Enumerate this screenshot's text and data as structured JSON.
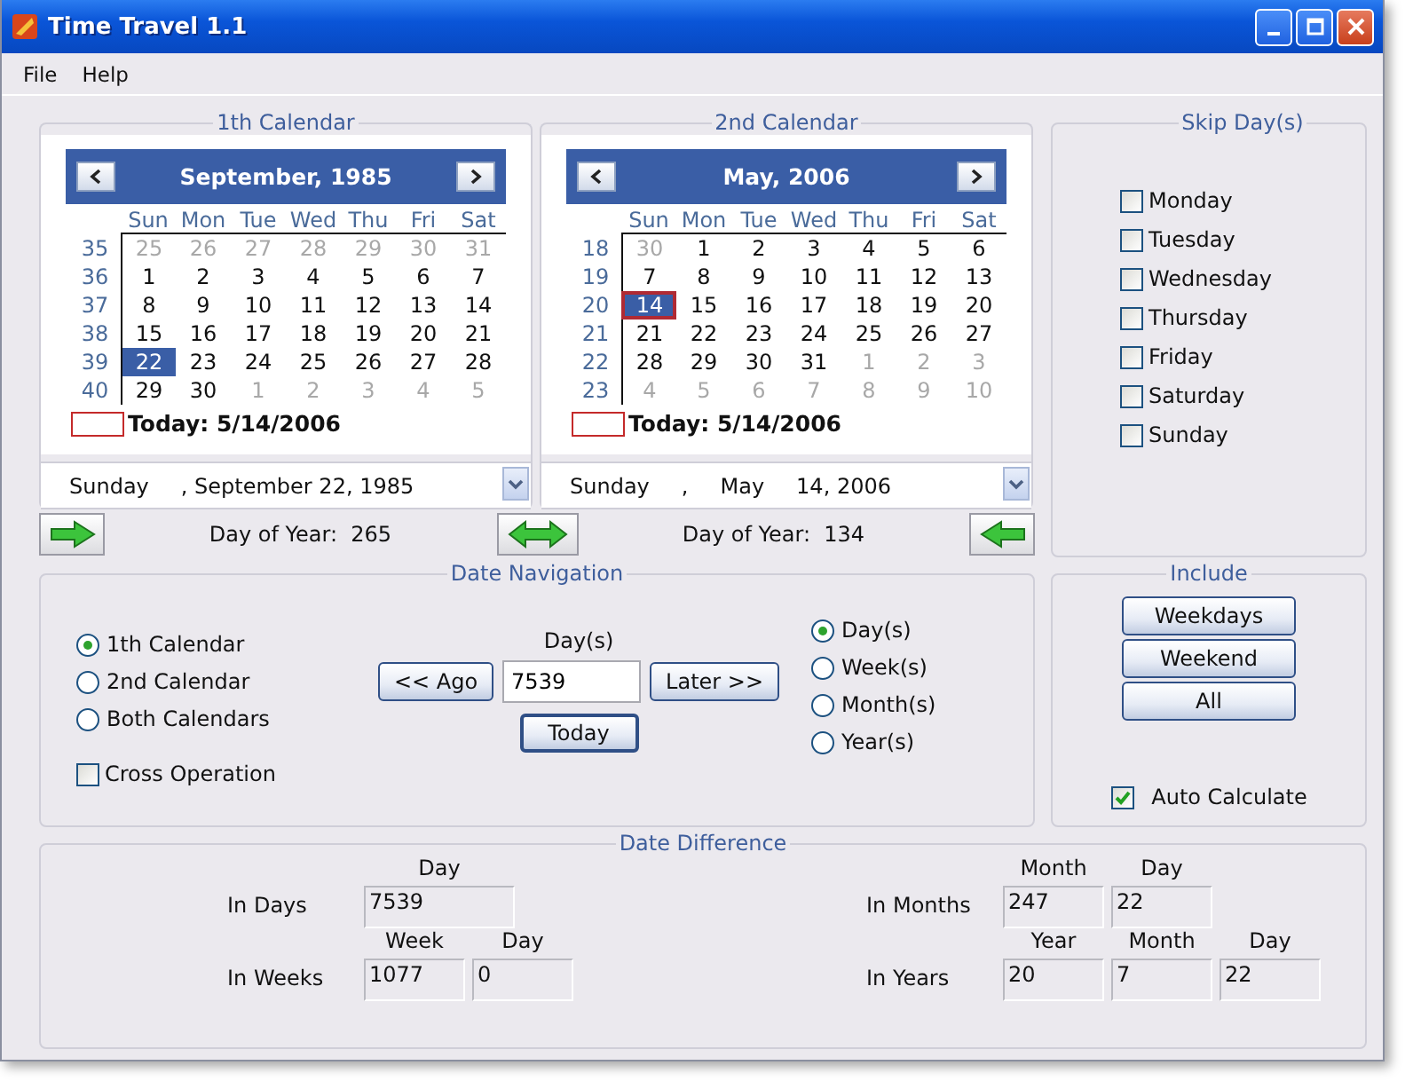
{
  "window": {
    "title": "Time Travel 1.1"
  },
  "menu": [
    "File",
    "Help"
  ],
  "calendars": [
    {
      "title": "1th Calendar",
      "month": "September, 1985",
      "weekdays": [
        "Sun",
        "Mon",
        "Tue",
        "Wed",
        "Thu",
        "Fri",
        "Sat"
      ],
      "weeks": [
        {
          "number": "35",
          "days": [
            {
              "d": "25",
              "other": true,
              "selected": false,
              "today": false
            },
            {
              "d": "26",
              "other": true,
              "selected": false,
              "today": false
            },
            {
              "d": "27",
              "other": true,
              "selected": false,
              "today": false
            },
            {
              "d": "28",
              "other": true,
              "selected": false,
              "today": false
            },
            {
              "d": "29",
              "other": true,
              "selected": false,
              "today": false
            },
            {
              "d": "30",
              "other": true,
              "selected": false,
              "today": false
            },
            {
              "d": "31",
              "other": true,
              "selected": false,
              "today": false
            }
          ]
        },
        {
          "number": "36",
          "days": [
            {
              "d": "1",
              "other": false,
              "selected": false,
              "today": false
            },
            {
              "d": "2",
              "other": false,
              "selected": false,
              "today": false
            },
            {
              "d": "3",
              "other": false,
              "selected": false,
              "today": false
            },
            {
              "d": "4",
              "other": false,
              "selected": false,
              "today": false
            },
            {
              "d": "5",
              "other": false,
              "selected": false,
              "today": false
            },
            {
              "d": "6",
              "other": false,
              "selected": false,
              "today": false
            },
            {
              "d": "7",
              "other": false,
              "selected": false,
              "today": false
            }
          ]
        },
        {
          "number": "37",
          "days": [
            {
              "d": "8",
              "other": false,
              "selected": false,
              "today": false
            },
            {
              "d": "9",
              "other": false,
              "selected": false,
              "today": false
            },
            {
              "d": "10",
              "other": false,
              "selected": false,
              "today": false
            },
            {
              "d": "11",
              "other": false,
              "selected": false,
              "today": false
            },
            {
              "d": "12",
              "other": false,
              "selected": false,
              "today": false
            },
            {
              "d": "13",
              "other": false,
              "selected": false,
              "today": false
            },
            {
              "d": "14",
              "other": false,
              "selected": false,
              "today": false
            }
          ]
        },
        {
          "number": "38",
          "days": [
            {
              "d": "15",
              "other": false,
              "selected": false,
              "today": false
            },
            {
              "d": "16",
              "other": false,
              "selected": false,
              "today": false
            },
            {
              "d": "17",
              "other": false,
              "selected": false,
              "today": false
            },
            {
              "d": "18",
              "other": false,
              "selected": false,
              "today": false
            },
            {
              "d": "19",
              "other": false,
              "selected": false,
              "today": false
            },
            {
              "d": "20",
              "other": false,
              "selected": false,
              "today": false
            },
            {
              "d": "21",
              "other": false,
              "selected": false,
              "today": false
            }
          ]
        },
        {
          "number": "39",
          "days": [
            {
              "d": "22",
              "other": false,
              "selected": true,
              "today": false
            },
            {
              "d": "23",
              "other": false,
              "selected": false,
              "today": false
            },
            {
              "d": "24",
              "other": false,
              "selected": false,
              "today": false
            },
            {
              "d": "25",
              "other": false,
              "selected": false,
              "today": false
            },
            {
              "d": "26",
              "other": false,
              "selected": false,
              "today": false
            },
            {
              "d": "27",
              "other": false,
              "selected": false,
              "today": false
            },
            {
              "d": "28",
              "other": false,
              "selected": false,
              "today": false
            }
          ]
        },
        {
          "number": "40",
          "days": [
            {
              "d": "29",
              "other": false,
              "selected": false,
              "today": false
            },
            {
              "d": "30",
              "other": false,
              "selected": false,
              "today": false
            },
            {
              "d": "1",
              "other": true,
              "selected": false,
              "today": false
            },
            {
              "d": "2",
              "other": true,
              "selected": false,
              "today": false
            },
            {
              "d": "3",
              "other": true,
              "selected": false,
              "today": false
            },
            {
              "d": "4",
              "other": true,
              "selected": false,
              "today": false
            },
            {
              "d": "5",
              "other": true,
              "selected": false,
              "today": false
            }
          ]
        }
      ],
      "today_label": "Today: 5/14/2006",
      "date_field": [
        "Sunday",
        ", September 22, 1985"
      ],
      "day_of_year_label": "Day of Year:",
      "day_of_year": "265"
    },
    {
      "title": "2nd Calendar",
      "month": "May, 2006",
      "weekdays": [
        "Sun",
        "Mon",
        "Tue",
        "Wed",
        "Thu",
        "Fri",
        "Sat"
      ],
      "weeks": [
        {
          "number": "18",
          "days": [
            {
              "d": "30",
              "other": true,
              "selected": false,
              "today": false
            },
            {
              "d": "1",
              "other": false,
              "selected": false,
              "today": false
            },
            {
              "d": "2",
              "other": false,
              "selected": false,
              "today": false
            },
            {
              "d": "3",
              "other": false,
              "selected": false,
              "today": false
            },
            {
              "d": "4",
              "other": false,
              "selected": false,
              "today": false
            },
            {
              "d": "5",
              "other": false,
              "selected": false,
              "today": false
            },
            {
              "d": "6",
              "other": false,
              "selected": false,
              "today": false
            }
          ]
        },
        {
          "number": "19",
          "days": [
            {
              "d": "7",
              "other": false,
              "selected": false,
              "today": false
            },
            {
              "d": "8",
              "other": false,
              "selected": false,
              "today": false
            },
            {
              "d": "9",
              "other": false,
              "selected": false,
              "today": false
            },
            {
              "d": "10",
              "other": false,
              "selected": false,
              "today": false
            },
            {
              "d": "11",
              "other": false,
              "selected": false,
              "today": false
            },
            {
              "d": "12",
              "other": false,
              "selected": false,
              "today": false
            },
            {
              "d": "13",
              "other": false,
              "selected": false,
              "today": false
            }
          ]
        },
        {
          "number": "20",
          "days": [
            {
              "d": "14",
              "other": false,
              "selected": true,
              "today": true
            },
            {
              "d": "15",
              "other": false,
              "selected": false,
              "today": false
            },
            {
              "d": "16",
              "other": false,
              "selected": false,
              "today": false
            },
            {
              "d": "17",
              "other": false,
              "selected": false,
              "today": false
            },
            {
              "d": "18",
              "other": false,
              "selected": false,
              "today": false
            },
            {
              "d": "19",
              "other": false,
              "selected": false,
              "today": false
            },
            {
              "d": "20",
              "other": false,
              "selected": false,
              "today": false
            }
          ]
        },
        {
          "number": "21",
          "days": [
            {
              "d": "21",
              "other": false,
              "selected": false,
              "today": false
            },
            {
              "d": "22",
              "other": false,
              "selected": false,
              "today": false
            },
            {
              "d": "23",
              "other": false,
              "selected": false,
              "today": false
            },
            {
              "d": "24",
              "other": false,
              "selected": false,
              "today": false
            },
            {
              "d": "25",
              "other": false,
              "selected": false,
              "today": false
            },
            {
              "d": "26",
              "other": false,
              "selected": false,
              "today": false
            },
            {
              "d": "27",
              "other": false,
              "selected": false,
              "today": false
            }
          ]
        },
        {
          "number": "22",
          "days": [
            {
              "d": "28",
              "other": false,
              "selected": false,
              "today": false
            },
            {
              "d": "29",
              "other": false,
              "selected": false,
              "today": false
            },
            {
              "d": "30",
              "other": false,
              "selected": false,
              "today": false
            },
            {
              "d": "31",
              "other": false,
              "selected": false,
              "today": false
            },
            {
              "d": "1",
              "other": true,
              "selected": false,
              "today": false
            },
            {
              "d": "2",
              "other": true,
              "selected": false,
              "today": false
            },
            {
              "d": "3",
              "other": true,
              "selected": false,
              "today": false
            }
          ]
        },
        {
          "number": "23",
          "days": [
            {
              "d": "4",
              "other": true,
              "selected": false,
              "today": false
            },
            {
              "d": "5",
              "other": true,
              "selected": false,
              "today": false
            },
            {
              "d": "6",
              "other": true,
              "selected": false,
              "today": false
            },
            {
              "d": "7",
              "other": true,
              "selected": false,
              "today": false
            },
            {
              "d": "8",
              "other": true,
              "selected": false,
              "today": false
            },
            {
              "d": "9",
              "other": true,
              "selected": false,
              "today": false
            },
            {
              "d": "10",
              "other": true,
              "selected": false,
              "today": false
            }
          ]
        }
      ],
      "today_label": "Today: 5/14/2006",
      "date_field": [
        "Sunday",
        ",",
        "May",
        "14, 2006"
      ],
      "day_of_year_label": "Day of Year:",
      "day_of_year": "134"
    }
  ],
  "skip_days": {
    "title": "Skip Day(s)",
    "days": [
      {
        "label": "Monday",
        "checked": false
      },
      {
        "label": "Tuesday",
        "checked": false
      },
      {
        "label": "Wednesday",
        "checked": false
      },
      {
        "label": "Thursday",
        "checked": false
      },
      {
        "label": "Friday",
        "checked": false
      },
      {
        "label": "Saturday",
        "checked": false
      },
      {
        "label": "Sunday",
        "checked": false
      }
    ]
  },
  "date_navigation": {
    "title": "Date Navigation",
    "targets": [
      {
        "label": "1th Calendar",
        "selected": true
      },
      {
        "label": "2nd Calendar",
        "selected": false
      },
      {
        "label": "Both Calendars",
        "selected": false
      }
    ],
    "cross_operation": {
      "label": "Cross Operation",
      "checked": false
    },
    "amount_label": "Day(s)",
    "amount": "7539",
    "ago_button": "<< Ago",
    "later_button": "Later >>",
    "today_button": "Today",
    "units": [
      {
        "label": "Day(s)",
        "selected": true
      },
      {
        "label": "Week(s)",
        "selected": false
      },
      {
        "label": "Month(s)",
        "selected": false
      },
      {
        "label": "Year(s)",
        "selected": false
      }
    ]
  },
  "include": {
    "title": "Include",
    "buttons": [
      "Weekdays",
      "Weekend",
      "All"
    ],
    "auto_calculate": {
      "label": "Auto Calculate",
      "checked": true
    }
  },
  "date_difference": {
    "title": "Date Difference",
    "rows": [
      {
        "label": "In Days",
        "fields": [
          {
            "header": "Day",
            "value": "7539"
          }
        ]
      },
      {
        "label": "In Months",
        "fields": [
          {
            "header": "Month",
            "value": "247"
          },
          {
            "header": "Day",
            "value": "22"
          }
        ]
      },
      {
        "label": "In Weeks",
        "fields": [
          {
            "header": "Week",
            "value": "1077"
          },
          {
            "header": "Day",
            "value": "0"
          }
        ]
      },
      {
        "label": "In Years",
        "fields": [
          {
            "header": "Year",
            "value": "20"
          },
          {
            "header": "Month",
            "value": "7"
          },
          {
            "header": "Day",
            "value": "22"
          }
        ]
      }
    ]
  }
}
